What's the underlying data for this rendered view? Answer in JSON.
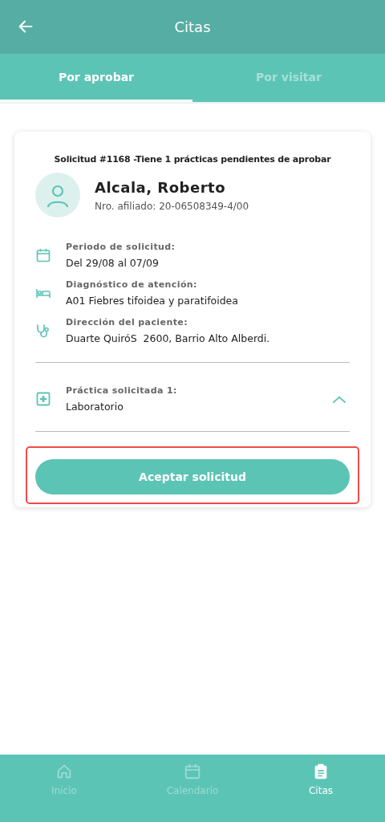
{
  "header": {
    "title": "Citas"
  },
  "tabs": [
    {
      "label": "Por aprobar",
      "selected": true
    },
    {
      "label": "Por visitar",
      "selected": false
    }
  ],
  "card": {
    "heading": "Solicitud #1168 -Tiene 1 prácticas pendientes de aprobar",
    "patient": {
      "name": "Alcala, Roberto",
      "member_number": "Nro. afiliado: 20-06508349-4/00"
    },
    "details": [
      {
        "kind": "calendar",
        "label": "Periodo de solicitud:",
        "value": "Del 29/08 al 07/09"
      },
      {
        "kind": "bed",
        "label": "Diagnóstico de atención:",
        "value": "A01 Fiebres tifoidea y paratifoidea"
      },
      {
        "kind": "stethoscope",
        "label": "Dirección del paciente:",
        "value": "Duarte QuiróS  2600, Barrio Alto Alberdi."
      }
    ],
    "practices": [
      {
        "label": "Práctica solicitada 1:",
        "value": "Laboratorio",
        "expanded": true
      }
    ],
    "action": {
      "label": "Aceptar solicitud",
      "highlighted": true
    }
  },
  "bottom_nav": [
    {
      "kind": "home",
      "label": "Inicio",
      "selected": false
    },
    {
      "kind": "calendar",
      "label": "Calendario",
      "selected": false
    },
    {
      "kind": "clipboard",
      "label": "Citas",
      "selected": true
    }
  ]
}
